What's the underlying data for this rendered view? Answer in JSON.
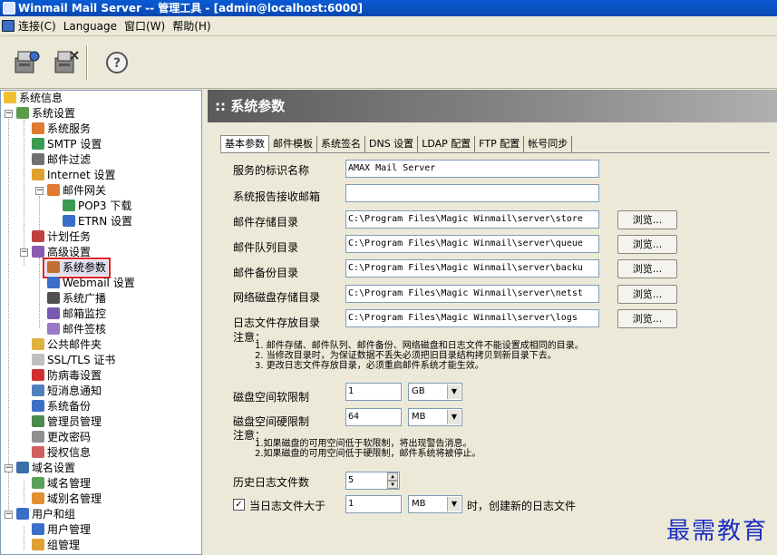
{
  "window": {
    "title": "Winmail Mail Server -- 管理工具 - [admin@localhost:6000]"
  },
  "menu": {
    "items": [
      "连接(C)",
      "Language",
      "窗口(W)",
      "帮助(H)"
    ]
  },
  "toolbar": {
    "icons": [
      "connect-icon",
      "disconnect-icon",
      "help-icon"
    ]
  },
  "tree": {
    "system_info": "系统信息",
    "system_settings": "系统设置",
    "system_service": "系统服务",
    "smtp_settings": "SMTP 设置",
    "mail_filter": "邮件过滤",
    "internet_settings": "Internet 设置",
    "mail_gateway": "邮件网关",
    "pop3_download": "POP3 下载",
    "etrn_settings": "ETRN 设置",
    "scheduled_tasks": "计划任务",
    "advanced_settings": "高级设置",
    "system_params": "系统参数",
    "webmail_settings": "Webmail 设置",
    "system_broadcast": "系统广播",
    "mailbox_monitor": "邮箱监控",
    "mail_signature": "邮件签核",
    "public_folder": "公共邮件夹",
    "ssl_cert": "SSL/TLS 证书",
    "antivirus": "防病毒设置",
    "sms_notify": "短消息通知",
    "system_backup": "系统备份",
    "admin_mgmt": "管理员管理",
    "change_password": "更改密码",
    "license_info": "授权信息",
    "domain_settings": "域名设置",
    "domain_mgmt": "域名管理",
    "domain_alias_mgmt": "域别名管理",
    "users_groups": "用户和组",
    "user_mgmt": "用户管理",
    "group_mgmt": "组管理"
  },
  "header": {
    "title": ":: 系统参数"
  },
  "tabs": [
    "基本参数",
    "邮件模板",
    "系统签名",
    "DNS 设置",
    "LDAP 配置",
    "FTP 配置",
    "帐号同步"
  ],
  "form": {
    "server_name_label": "服务的标识名称",
    "server_name_value": "AMAX Mail Server",
    "report_mail_label": "系统报告接收邮箱",
    "report_mail_value": "",
    "store_dir_label": "邮件存储目录",
    "store_dir_value": "C:\\Program Files\\Magic Winmail\\server\\store",
    "queue_dir_label": "邮件队列目录",
    "queue_dir_value": "C:\\Program Files\\Magic Winmail\\server\\queue",
    "backup_dir_label": "邮件备份目录",
    "backup_dir_value": "C:\\Program Files\\Magic Winmail\\server\\backu",
    "netdisk_dir_label": "网络磁盘存储目录",
    "netdisk_dir_value": "C:\\Program Files\\Magic Winmail\\server\\netst",
    "log_dir_label": "日志文件存放目录",
    "log_dir_value": "C:\\Program Files\\Magic Winmail\\server\\logs",
    "browse_label": "浏览...",
    "note1_title": "注意：",
    "note1_lines": [
      "1. 邮件存储、邮件队列、邮件备份、网络磁盘和日志文件不能设置成相同的目录。",
      "2. 当修改目录时，为保证数据不丢失必须把旧目录结构拷贝到新目录下去。",
      "3. 更改日志文件存放目录，必须重启邮件系统才能生效。"
    ],
    "soft_limit_label": "磁盘空间软限制",
    "soft_limit_value": "1",
    "soft_limit_unit": "GB",
    "hard_limit_label": "磁盘空间硬限制",
    "hard_limit_value": "64",
    "hard_limit_unit": "MB",
    "note2_title": "注意：",
    "note2_lines": [
      "1.如果磁盘的可用空间低于软限制，将出现警告消息。",
      "2.如果磁盘的可用空间低于硬限制，邮件系统将被停止。"
    ],
    "history_log_label": "历史日志文件数",
    "history_log_value": "5",
    "log_size_checkbox_label": "当日志文件大于",
    "log_size_value": "1",
    "log_size_unit": "MB",
    "log_size_suffix": "时，创建新的日志文件"
  },
  "watermark": "最需教育"
}
